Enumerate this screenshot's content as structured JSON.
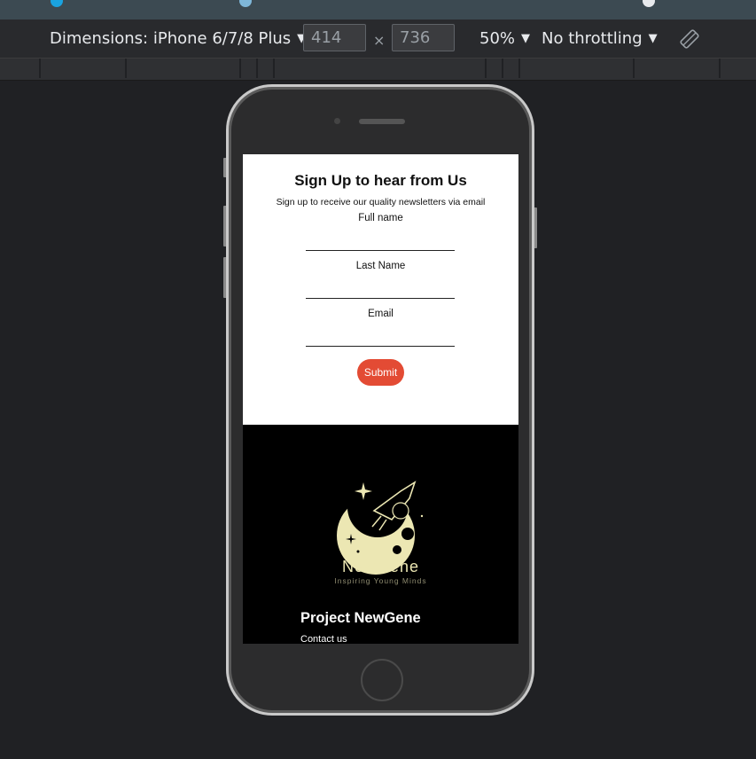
{
  "toolbar": {
    "dimensions_label": "Dimensions: iPhone 6/7/8 Plus",
    "width_value": "414",
    "height_value": "736",
    "times_symbol": "×",
    "zoom_label": "50%",
    "throttling_label": "No throttling",
    "caret": "▼",
    "rotate_icon": "rotate-icon"
  },
  "signup": {
    "title": "Sign Up to hear from Us",
    "subtitle": "Sign up to receive our quality newsletters via email",
    "fields": [
      {
        "label": "Full name",
        "value": ""
      },
      {
        "label": "Last Name",
        "value": ""
      },
      {
        "label": "Email",
        "value": ""
      }
    ],
    "submit_label": "Submit",
    "submit_color": "#e34b34"
  },
  "footer": {
    "logo_name": "NewGene",
    "logo_tagline": "Inspiring Young Minds",
    "project_title": "Project NewGene",
    "contact_link": "Contact us",
    "logo_color": "#ece7b3"
  }
}
